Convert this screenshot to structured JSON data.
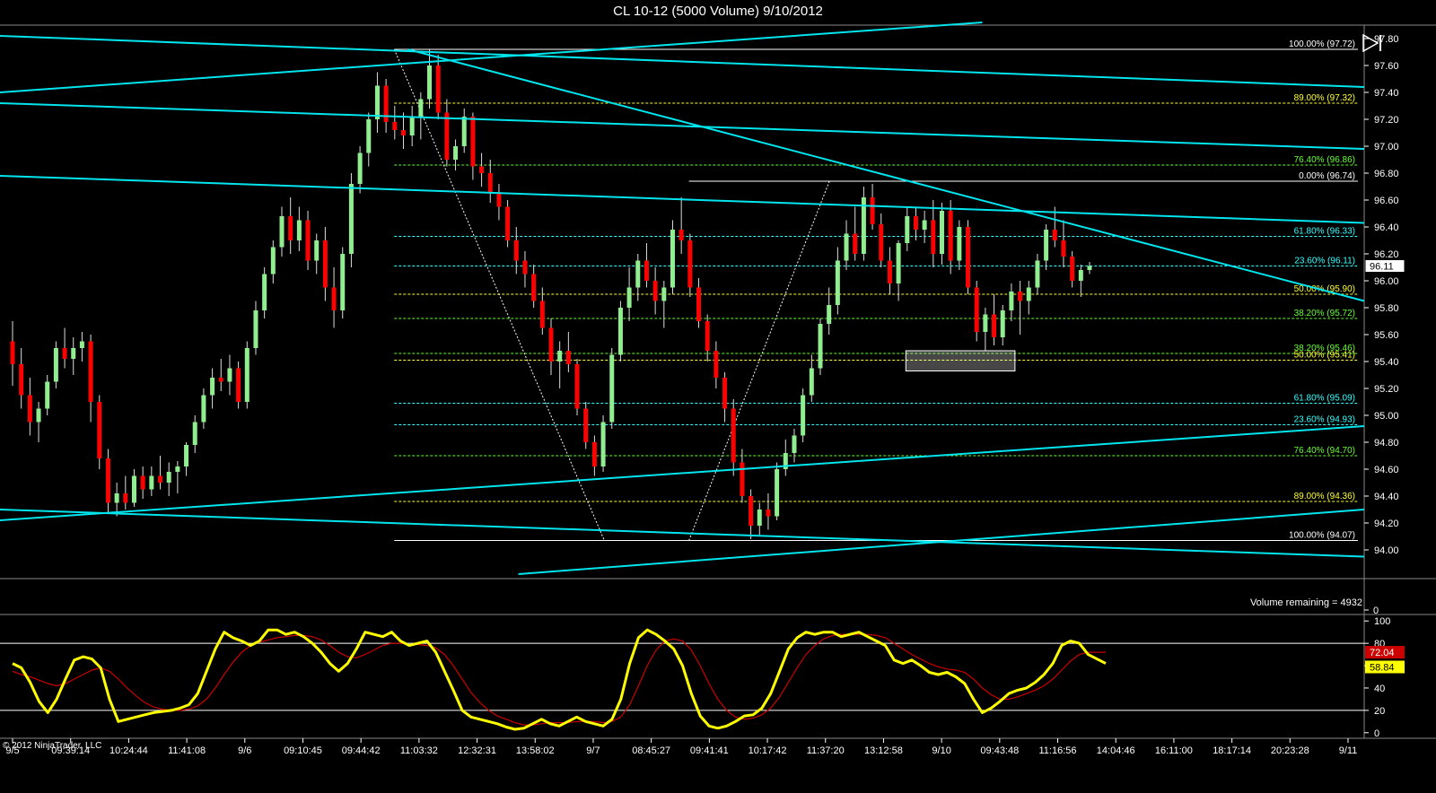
{
  "title": "CL 10-12 (5000 Volume)  9/10/2012",
  "volume_remaining": "Volume remaining = 4932",
  "copyright": "© 2012 NinjaTrader, LLC",
  "play_icon": "play-end-icon",
  "colors": {
    "background": "#000000",
    "up_candle": "#90ee90",
    "down_candle": "#ff0000",
    "trendline": "#00e5ee",
    "stoch_k": "#ffff00",
    "stoch_d": "#cc0000",
    "fib_green": "#66ff33",
    "fib_cyan": "#33ffff",
    "fib_yellow": "#ffff33",
    "fib_white": "#ffffff"
  },
  "chart_data": [
    {
      "type": "candlestick",
      "title": "CL 10-12 (5000 Volume)  9/10/2012",
      "ylim": [
        93.8,
        97.9
      ],
      "y_ticks": [
        "97.80",
        "97.60",
        "97.40",
        "97.20",
        "97.00",
        "96.80",
        "96.60",
        "96.40",
        "96.20",
        "96.00",
        "95.80",
        "95.60",
        "95.40",
        "95.20",
        "95.00",
        "94.80",
        "94.60",
        "94.40",
        "94.20",
        "94.00"
      ],
      "x_labels": [
        "9/5",
        "09:39:14",
        "10:24:44",
        "11:41:08",
        "9/6",
        "09:10:45",
        "09:44:42",
        "11:03:32",
        "12:32:31",
        "13:58:02",
        "9/7",
        "08:45:27",
        "09:41:41",
        "10:17:42",
        "11:37:20",
        "13:12:58",
        "9/10",
        "09:43:48",
        "11:16:56",
        "14:04:46",
        "16:11:00",
        "18:17:14",
        "20:23:28",
        "9/11"
      ],
      "last_price": "96.11",
      "candles": [
        [
          95.55,
          95.7,
          95.22,
          95.38
        ],
        [
          95.38,
          95.5,
          95.05,
          95.15
        ],
        [
          95.15,
          95.28,
          94.85,
          94.95
        ],
        [
          94.95,
          95.1,
          94.8,
          95.05
        ],
        [
          95.05,
          95.3,
          95.0,
          95.25
        ],
        [
          95.25,
          95.55,
          95.2,
          95.5
        ],
        [
          95.5,
          95.65,
          95.35,
          95.42
        ],
        [
          95.42,
          95.58,
          95.3,
          95.5
        ],
        [
          95.5,
          95.62,
          95.4,
          95.55
        ],
        [
          95.55,
          95.6,
          94.95,
          95.1
        ],
        [
          95.1,
          95.15,
          94.6,
          94.68
        ],
        [
          94.68,
          94.75,
          94.28,
          94.35
        ],
        [
          94.35,
          94.5,
          94.25,
          94.42
        ],
        [
          94.42,
          94.55,
          94.3,
          94.35
        ],
        [
          94.35,
          94.6,
          94.32,
          94.55
        ],
        [
          94.55,
          94.62,
          94.38,
          94.45
        ],
        [
          94.45,
          94.62,
          94.4,
          94.55
        ],
        [
          94.55,
          94.7,
          94.45,
          94.5
        ],
        [
          94.5,
          94.65,
          94.4,
          94.58
        ],
        [
          94.58,
          94.66,
          94.42,
          94.62
        ],
        [
          94.62,
          94.8,
          94.55,
          94.78
        ],
        [
          94.78,
          95.0,
          94.72,
          94.95
        ],
        [
          94.95,
          95.2,
          94.9,
          95.15
        ],
        [
          95.15,
          95.35,
          95.05,
          95.28
        ],
        [
          95.28,
          95.42,
          95.18,
          95.25
        ],
        [
          95.25,
          95.45,
          95.15,
          95.35
        ],
        [
          95.35,
          95.4,
          95.05,
          95.1
        ],
        [
          95.1,
          95.55,
          95.05,
          95.5
        ],
        [
          95.5,
          95.85,
          95.45,
          95.78
        ],
        [
          95.78,
          96.1,
          95.72,
          96.05
        ],
        [
          96.05,
          96.3,
          95.98,
          96.25
        ],
        [
          96.25,
          96.55,
          96.18,
          96.48
        ],
        [
          96.48,
          96.62,
          96.2,
          96.3
        ],
        [
          96.3,
          96.55,
          96.22,
          96.45
        ],
        [
          96.45,
          96.52,
          96.08,
          96.15
        ],
        [
          96.15,
          96.35,
          96.05,
          96.3
        ],
        [
          96.3,
          96.4,
          95.85,
          95.95
        ],
        [
          95.95,
          96.1,
          95.65,
          95.78
        ],
        [
          95.78,
          96.25,
          95.72,
          96.2
        ],
        [
          96.2,
          96.8,
          96.1,
          96.72
        ],
        [
          96.72,
          97.0,
          96.65,
          96.95
        ],
        [
          96.95,
          97.25,
          96.85,
          97.2
        ],
        [
          97.2,
          97.55,
          97.1,
          97.45
        ],
        [
          97.45,
          97.5,
          97.1,
          97.18
        ],
        [
          97.18,
          97.3,
          97.05,
          97.12
        ],
        [
          97.12,
          97.25,
          96.98,
          97.08
        ],
        [
          97.08,
          97.3,
          97.0,
          97.22
        ],
        [
          97.22,
          97.4,
          97.05,
          97.35
        ],
        [
          97.35,
          97.72,
          97.28,
          97.6
        ],
        [
          97.6,
          97.68,
          97.2,
          97.25
        ],
        [
          97.25,
          97.35,
          96.85,
          96.9
        ],
        [
          96.9,
          97.05,
          96.82,
          97.0
        ],
        [
          97.0,
          97.28,
          96.95,
          97.22
        ],
        [
          97.22,
          97.25,
          96.75,
          96.85
        ],
        [
          96.85,
          96.95,
          96.7,
          96.8
        ],
        [
          96.8,
          96.9,
          96.58,
          96.65
        ],
        [
          96.65,
          96.72,
          96.45,
          96.55
        ],
        [
          96.55,
          96.6,
          96.25,
          96.3
        ],
        [
          96.3,
          96.4,
          96.05,
          96.15
        ],
        [
          96.15,
          96.22,
          95.95,
          96.05
        ],
        [
          96.05,
          96.12,
          95.8,
          95.85
        ],
        [
          95.85,
          95.95,
          95.6,
          95.65
        ],
        [
          95.65,
          95.72,
          95.3,
          95.4
        ],
        [
          95.4,
          95.55,
          95.2,
          95.48
        ],
        [
          95.48,
          95.62,
          95.32,
          95.38
        ],
        [
          95.38,
          95.42,
          95.0,
          95.05
        ],
        [
          95.05,
          95.1,
          94.75,
          94.8
        ],
        [
          94.8,
          94.85,
          94.55,
          94.62
        ],
        [
          94.62,
          95.0,
          94.58,
          94.95
        ],
        [
          94.95,
          95.5,
          94.9,
          95.45
        ],
        [
          95.45,
          95.85,
          95.4,
          95.8
        ],
        [
          95.8,
          96.1,
          95.7,
          95.95
        ],
        [
          95.95,
          96.2,
          95.85,
          96.15
        ],
        [
          96.15,
          96.28,
          95.95,
          96.0
        ],
        [
          96.0,
          96.1,
          95.75,
          95.85
        ],
        [
          95.85,
          96.0,
          95.65,
          95.95
        ],
        [
          95.95,
          96.45,
          95.9,
          96.38
        ],
        [
          96.38,
          96.62,
          96.2,
          96.3
        ],
        [
          96.3,
          96.35,
          95.88,
          95.95
        ],
        [
          95.95,
          96.02,
          95.65,
          95.7
        ],
        [
          95.7,
          95.75,
          95.4,
          95.48
        ],
        [
          95.48,
          95.55,
          95.2,
          95.28
        ],
        [
          95.28,
          95.32,
          94.95,
          95.05
        ],
        [
          95.05,
          95.12,
          94.55,
          94.65
        ],
        [
          94.65,
          94.75,
          94.35,
          94.4
        ],
        [
          94.4,
          94.45,
          94.08,
          94.18
        ],
        [
          94.18,
          94.35,
          94.1,
          94.3
        ],
        [
          94.3,
          94.42,
          94.15,
          94.25
        ],
        [
          94.25,
          94.65,
          94.22,
          94.6
        ],
        [
          94.6,
          94.82,
          94.55,
          94.72
        ],
        [
          94.72,
          94.9,
          94.65,
          94.85
        ],
        [
          94.85,
          95.2,
          94.8,
          95.15
        ],
        [
          95.15,
          95.45,
          95.1,
          95.35
        ],
        [
          95.35,
          95.72,
          95.3,
          95.68
        ],
        [
          95.68,
          95.95,
          95.6,
          95.82
        ],
        [
          95.82,
          96.25,
          95.75,
          96.15
        ],
        [
          96.15,
          96.45,
          96.08,
          96.35
        ],
        [
          96.35,
          96.55,
          96.15,
          96.2
        ],
        [
          96.2,
          96.7,
          96.15,
          96.62
        ],
        [
          96.62,
          96.72,
          96.38,
          96.42
        ],
        [
          96.42,
          96.5,
          96.1,
          96.15
        ],
        [
          96.15,
          96.25,
          95.9,
          95.98
        ],
        [
          95.98,
          96.3,
          95.85,
          96.28
        ],
        [
          96.28,
          96.55,
          96.22,
          96.48
        ],
        [
          96.48,
          96.55,
          96.3,
          96.38
        ],
        [
          96.38,
          96.52,
          96.28,
          96.45
        ],
        [
          96.45,
          96.6,
          96.1,
          96.2
        ],
        [
          96.2,
          96.58,
          96.12,
          96.52
        ],
        [
          96.52,
          96.6,
          96.05,
          96.15
        ],
        [
          96.15,
          96.45,
          96.08,
          96.4
        ],
        [
          96.4,
          96.45,
          95.9,
          95.95
        ],
        [
          95.95,
          96.0,
          95.55,
          95.62
        ],
        [
          95.62,
          95.8,
          95.48,
          95.75
        ],
        [
          95.75,
          95.9,
          95.52,
          95.58
        ],
        [
          95.58,
          95.82,
          95.52,
          95.78
        ],
        [
          95.78,
          95.98,
          95.7,
          95.92
        ],
        [
          95.92,
          96.0,
          95.6,
          95.85
        ],
        [
          95.85,
          96.0,
          95.75,
          95.95
        ],
        [
          95.95,
          96.2,
          95.9,
          96.15
        ],
        [
          96.15,
          96.42,
          96.08,
          96.38
        ],
        [
          96.38,
          96.55,
          96.25,
          96.3
        ],
        [
          96.3,
          96.45,
          96.1,
          96.18
        ],
        [
          96.18,
          96.22,
          95.95,
          96.0
        ],
        [
          96.0,
          96.12,
          95.88,
          96.08
        ],
        [
          96.08,
          96.14,
          96.05,
          96.11
        ]
      ],
      "fib_levels": [
        {
          "label": "100.00% (97.72)",
          "value": 97.72,
          "color": "#ffffff"
        },
        {
          "label": "89.00% (97.32)",
          "value": 97.32,
          "color": "#ffff33"
        },
        {
          "label": "76.40% (96.86)",
          "value": 96.86,
          "color": "#66ff33"
        },
        {
          "label": "0.00% (96.74)",
          "value": 96.74,
          "color": "#ffffff"
        },
        {
          "label": "61.80% (96.33)",
          "value": 96.33,
          "color": "#33ffff"
        },
        {
          "label": "23.60% (96.11)",
          "value": 96.11,
          "color": "#33ffff"
        },
        {
          "label": "50.00% (95.90)",
          "value": 95.9,
          "color": "#ffff33"
        },
        {
          "label": "38.20% (95.72)",
          "value": 95.72,
          "color": "#66ff33"
        },
        {
          "label": "38.20% (95.46)",
          "value": 95.46,
          "color": "#66ff33"
        },
        {
          "label": "50.00% (95.41)",
          "value": 95.41,
          "color": "#ffff33"
        },
        {
          "label": "61.80% (95.09)",
          "value": 95.09,
          "color": "#33ffff"
        },
        {
          "label": "23.60% (94.93)",
          "value": 94.93,
          "color": "#33ffff"
        },
        {
          "label": "76.40% (94.70)",
          "value": 94.7,
          "color": "#66ff33"
        },
        {
          "label": "89.00% (94.36)",
          "value": 94.36,
          "color": "#ffff33"
        },
        {
          "label": "100.00% (94.07)",
          "value": 94.07,
          "color": "#ffffff"
        }
      ],
      "trendlines": [
        {
          "x0": 0.0,
          "y0": 97.4,
          "x1": 0.72,
          "y1": 97.92
        },
        {
          "x0": 0.0,
          "y0": 97.82,
          "x1": 1.0,
          "y1": 97.44
        },
        {
          "x0": 0.0,
          "y0": 97.32,
          "x1": 1.0,
          "y1": 96.98
        },
        {
          "x0": 0.0,
          "y0": 96.78,
          "x1": 1.0,
          "y1": 96.43
        },
        {
          "x0": 0.299,
          "y0": 97.72,
          "x1": 1.0,
          "y1": 95.85
        },
        {
          "x0": 0.0,
          "y0": 94.22,
          "x1": 1.0,
          "y1": 94.92
        },
        {
          "x0": 0.0,
          "y0": 94.3,
          "x1": 1.0,
          "y1": 93.95
        },
        {
          "x0": 0.38,
          "y0": 93.82,
          "x1": 1.0,
          "y1": 94.3
        }
      ],
      "fib_swings": [
        {
          "x0": 0.289,
          "y0": 97.72,
          "x1": 0.443,
          "y1": 94.07
        },
        {
          "x0": 0.505,
          "y0": 94.07,
          "x1": 0.608,
          "y1": 96.74
        }
      ],
      "highlight_box": {
        "x0": 0.664,
        "x1": 0.744,
        "y_top": 95.48,
        "y_bottom": 95.33
      }
    },
    {
      "type": "line",
      "ylim": [
        -5,
        105
      ],
      "y_ticks": [
        "100",
        "80",
        "60",
        "40",
        "20",
        "0"
      ],
      "markers": [
        "72.04",
        "58.84"
      ],
      "reference_lines": [
        80,
        20
      ],
      "series": [
        {
          "values": [
            62,
            58,
            45,
            28,
            18,
            30,
            48,
            65,
            68,
            66,
            58,
            30,
            10,
            12,
            14,
            16,
            18,
            19,
            20,
            22,
            25,
            35,
            55,
            75,
            90,
            85,
            82,
            78,
            82,
            92,
            92,
            88,
            90,
            86,
            80,
            72,
            62,
            55,
            62,
            75,
            90,
            88,
            86,
            90,
            82,
            78,
            80,
            82,
            72,
            55,
            38,
            20,
            14,
            12,
            10,
            8,
            5,
            3,
            4,
            8,
            12,
            8,
            6,
            10,
            14,
            10,
            8,
            6,
            12,
            30,
            62,
            85,
            92,
            88,
            82,
            75,
            60,
            35,
            15,
            6,
            4,
            6,
            10,
            15,
            16,
            22,
            35,
            55,
            75,
            85,
            90,
            88,
            90,
            90,
            86,
            88,
            90,
            86,
            82,
            78,
            65,
            62,
            65,
            60,
            54,
            52,
            54,
            50,
            44,
            30,
            18,
            22,
            28,
            35,
            38,
            40,
            45,
            52,
            62,
            78,
            82,
            80,
            70,
            66,
            62
          ]
        },
        {
          "values": [
            55,
            52,
            50,
            47,
            44,
            42,
            44,
            48,
            52,
            56,
            58,
            55,
            48,
            40,
            33,
            27,
            23,
            21,
            20,
            20,
            21,
            24,
            30,
            40,
            52,
            63,
            72,
            78,
            81,
            83,
            85,
            86,
            87,
            87,
            86,
            83,
            78,
            72,
            68,
            67,
            70,
            74,
            78,
            80,
            80,
            79,
            79,
            78,
            76,
            70,
            60,
            48,
            36,
            27,
            20,
            15,
            12,
            9,
            7,
            7,
            8,
            9,
            9,
            9,
            10,
            10,
            10,
            9,
            10,
            14,
            25,
            42,
            60,
            74,
            82,
            84,
            82,
            74,
            60,
            44,
            30,
            20,
            14,
            12,
            13,
            16,
            22,
            32,
            45,
            58,
            70,
            78,
            84,
            87,
            88,
            88,
            88,
            88,
            87,
            85,
            80,
            75,
            70,
            66,
            62,
            59,
            57,
            56,
            54,
            48,
            40,
            34,
            30,
            30,
            32,
            35,
            38,
            42,
            48,
            56,
            64,
            70,
            72,
            72,
            72
          ]
        }
      ]
    }
  ]
}
